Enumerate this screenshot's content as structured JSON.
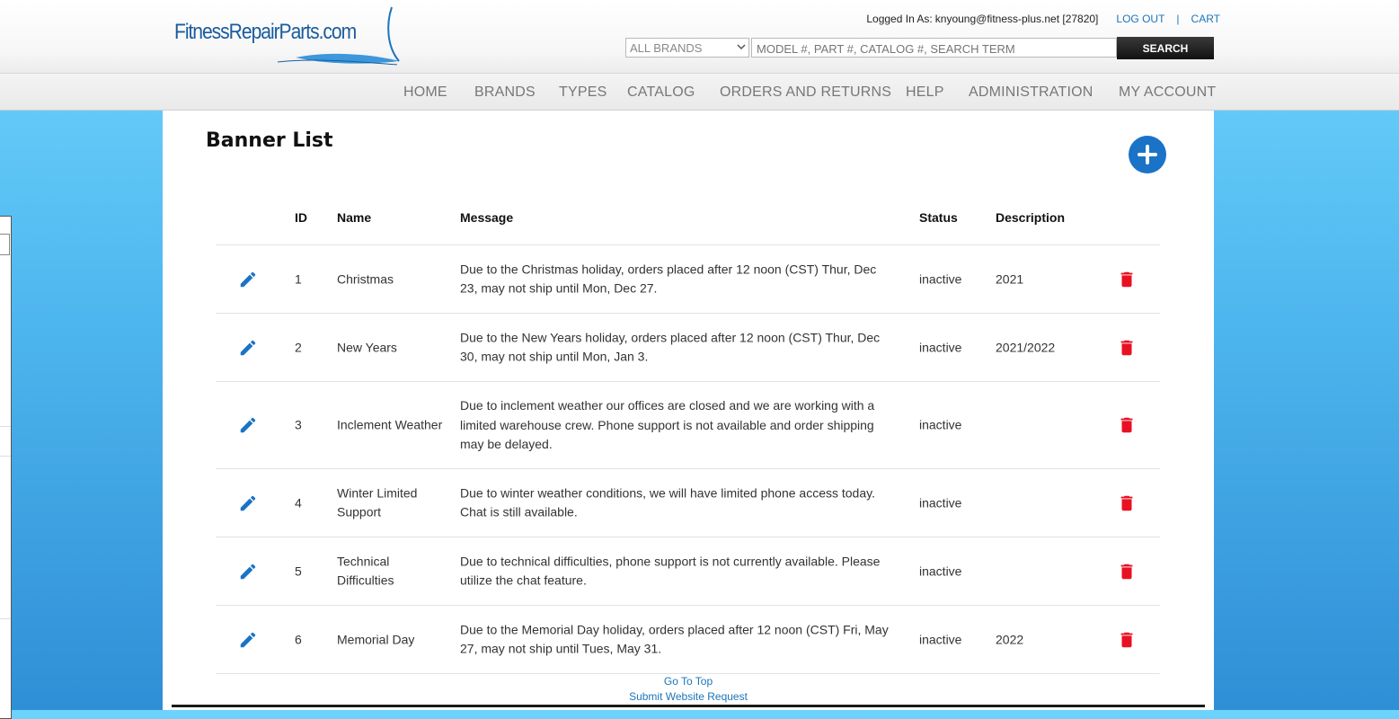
{
  "header": {
    "logo_text": "FitnessRepairParts.com",
    "login_label": "Logged In As:",
    "user": "knyoung@fitness-plus.net [27820]",
    "logout": "LOG OUT",
    "separator": "|",
    "cart": "CART",
    "brand_select": "ALL BRANDS",
    "search_placeholder": "MODEL #, PART #, CATALOG #, SEARCH TERM",
    "search_button": "SEARCH"
  },
  "nav": [
    "HOME",
    "BRANDS",
    "TYPES",
    "CATALOG",
    "ORDERS AND RETURNS",
    "HELP",
    "ADMINISTRATION",
    "MY ACCOUNT"
  ],
  "page": {
    "title": "Banner List"
  },
  "table": {
    "headers": {
      "id": "ID",
      "name": "Name",
      "message": "Message",
      "status": "Status",
      "description": "Description"
    },
    "rows": [
      {
        "id": "1",
        "name": "Christmas",
        "message": "Due to the Christmas holiday, orders placed after 12 noon (CST) Thur, Dec 23, may not ship until Mon, Dec 27.",
        "status": "inactive",
        "description": "2021"
      },
      {
        "id": "2",
        "name": "New Years",
        "message": "Due to the New Years holiday, orders placed after 12 noon (CST) Thur, Dec 30, may not ship until Mon, Jan 3.",
        "status": "inactive",
        "description": "2021/2022"
      },
      {
        "id": "3",
        "name": "Inclement Weather",
        "message": "Due to inclement weather our offices are closed and we are working with a limited warehouse crew. Phone support is not available and order shipping may be delayed.",
        "status": "inactive",
        "description": ""
      },
      {
        "id": "4",
        "name": "Winter Limited Support",
        "message": "Due to winter weather conditions, we will have limited phone access today. Chat is still available.",
        "status": "inactive",
        "description": ""
      },
      {
        "id": "5",
        "name": "Technical Difficulties",
        "message": "Due to technical difficulties, phone support is not currently available. Please utilize the chat feature.",
        "status": "inactive",
        "description": ""
      },
      {
        "id": "6",
        "name": "Memorial Day",
        "message": "Due to the Memorial Day holiday, orders placed after 12 noon (CST) Fri, May 27, may not ship until Tues, May 31.",
        "status": "inactive",
        "description": "2022"
      }
    ]
  },
  "footer": {
    "go_to_top": "Go To Top",
    "submit_request": "Submit Website Request"
  },
  "colors": {
    "accent": "#1a73c7",
    "delete": "#e81123",
    "link": "#1b75bb"
  },
  "icons": {
    "edit": "pencil-icon",
    "delete": "trash-icon",
    "add": "plus-icon"
  }
}
